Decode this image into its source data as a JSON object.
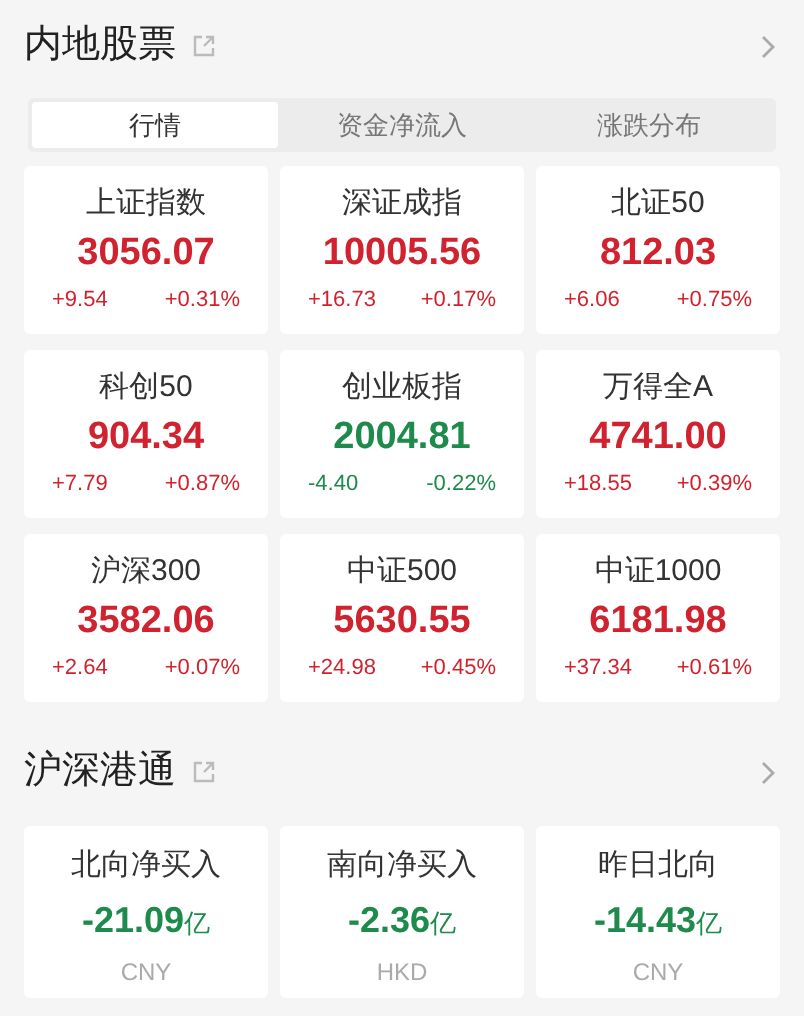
{
  "market": {
    "title": "内地股票",
    "tabs": [
      {
        "label": "行情",
        "selected": true
      },
      {
        "label": "资金净流入",
        "selected": false
      },
      {
        "label": "涨跌分布",
        "selected": false
      }
    ],
    "indices": [
      {
        "name": "上证指数",
        "price": "3056.07",
        "change": "+9.54",
        "percent": "+0.31%",
        "color": "#d0232f"
      },
      {
        "name": "深证成指",
        "price": "10005.56",
        "change": "+16.73",
        "percent": "+0.17%",
        "color": "#d0232f"
      },
      {
        "name": "北证50",
        "price": "812.03",
        "change": "+6.06",
        "percent": "+0.75%",
        "color": "#d0232f"
      },
      {
        "name": "科创50",
        "price": "904.34",
        "change": "+7.79",
        "percent": "+0.87%",
        "color": "#d0232f"
      },
      {
        "name": "创业板指",
        "price": "2004.81",
        "change": "-4.40",
        "percent": "-0.22%",
        "color": "#1e8a4c"
      },
      {
        "name": "万得全A",
        "price": "4741.00",
        "change": "+18.55",
        "percent": "+0.39%",
        "color": "#d0232f"
      },
      {
        "name": "沪深300",
        "price": "3582.06",
        "change": "+2.64",
        "percent": "+0.07%",
        "color": "#d0232f"
      },
      {
        "name": "中证500",
        "price": "5630.55",
        "change": "+24.98",
        "percent": "+0.45%",
        "color": "#d0232f"
      },
      {
        "name": "中证1000",
        "price": "6181.98",
        "change": "+37.34",
        "percent": "+0.61%",
        "color": "#d0232f"
      }
    ]
  },
  "connect": {
    "title": "沪深港通",
    "flows": [
      {
        "label": "北向净买入",
        "value": "-21.09",
        "unit": "亿",
        "currency": "CNY",
        "color": "#1e8a4c"
      },
      {
        "label": "南向净买入",
        "value": "-2.36",
        "unit": "亿",
        "currency": "HKD",
        "color": "#1e8a4c"
      },
      {
        "label": "昨日北向",
        "value": "-14.43",
        "unit": "亿",
        "currency": "CNY",
        "color": "#1e8a4c"
      }
    ]
  }
}
